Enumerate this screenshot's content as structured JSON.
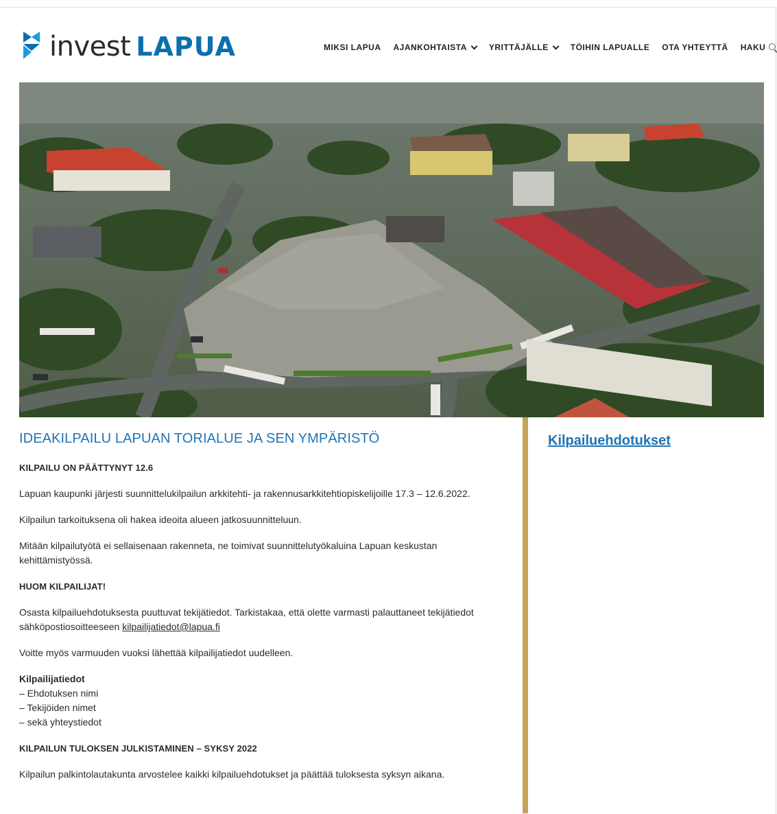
{
  "logo": {
    "invest": "invest",
    "lapua": "LAPUA"
  },
  "nav": {
    "items": [
      {
        "label": "MIKSI LAPUA",
        "dropdown": false
      },
      {
        "label": "AJANKOHTAISTA",
        "dropdown": true
      },
      {
        "label": "YRITTÄJÄLLE",
        "dropdown": true
      },
      {
        "label": "TÖIHIN LAPUALLE",
        "dropdown": false
      },
      {
        "label": "OTA YHTEYTTÄ",
        "dropdown": false
      }
    ],
    "search_label": "HAKU"
  },
  "article": {
    "title": "IDEAKILPAILU LAPUAN TORIALUE JA SEN YMPÄRISTÖ",
    "status": "KILPAILU ON PÄÄTTYNYT 12.6",
    "p1": "Lapuan kaupunki järjesti suunnittelukilpailun arkkitehti- ja rakennusarkkitehtiopiskelijoille 17.3 – 12.6.2022.",
    "p2": "Kilpailun tarkoituksena oli hakea ideoita alueen jatkosuunnitteluun.",
    "p3": "Mitään kilpailutyötä ei sellaisenaan rakenneta, ne toimivat suunnittelutyökaluina Lapuan keskustan kehittämistyössä.",
    "notice_heading": "HUOM KILPAILIJAT!",
    "notice_text": "Osasta kilpailuehdotuksesta puuttuvat tekijätiedot. Tarkistakaa, että olette varmasti palauttaneet tekijätiedot sähköpostiosoitteeseen",
    "email": "kilpailijatiedot@lapua.fi",
    "resend": "Voitte myös varmuuden vuoksi lähettää kilpailijatiedot uudelleen.",
    "info_heading": "Kilpailijatiedot",
    "info_items": [
      "– Ehdotuksen nimi",
      "– Tekijöiden nimet",
      "– sekä yhteystiedot"
    ],
    "results_heading": "KILPAILUN TULOKSEN JULKISTAMINEN – SYKSY 2022",
    "results_text": "Kilpailun palkintolautakunta arvostelee kaikki kilpailuehdotukset ja päättää tuloksesta syksyn aikana."
  },
  "sidebar": {
    "link": "Kilpailuehdotukset"
  },
  "colors": {
    "brand_blue": "#1f74b5",
    "divider_gold": "#c9a259"
  }
}
